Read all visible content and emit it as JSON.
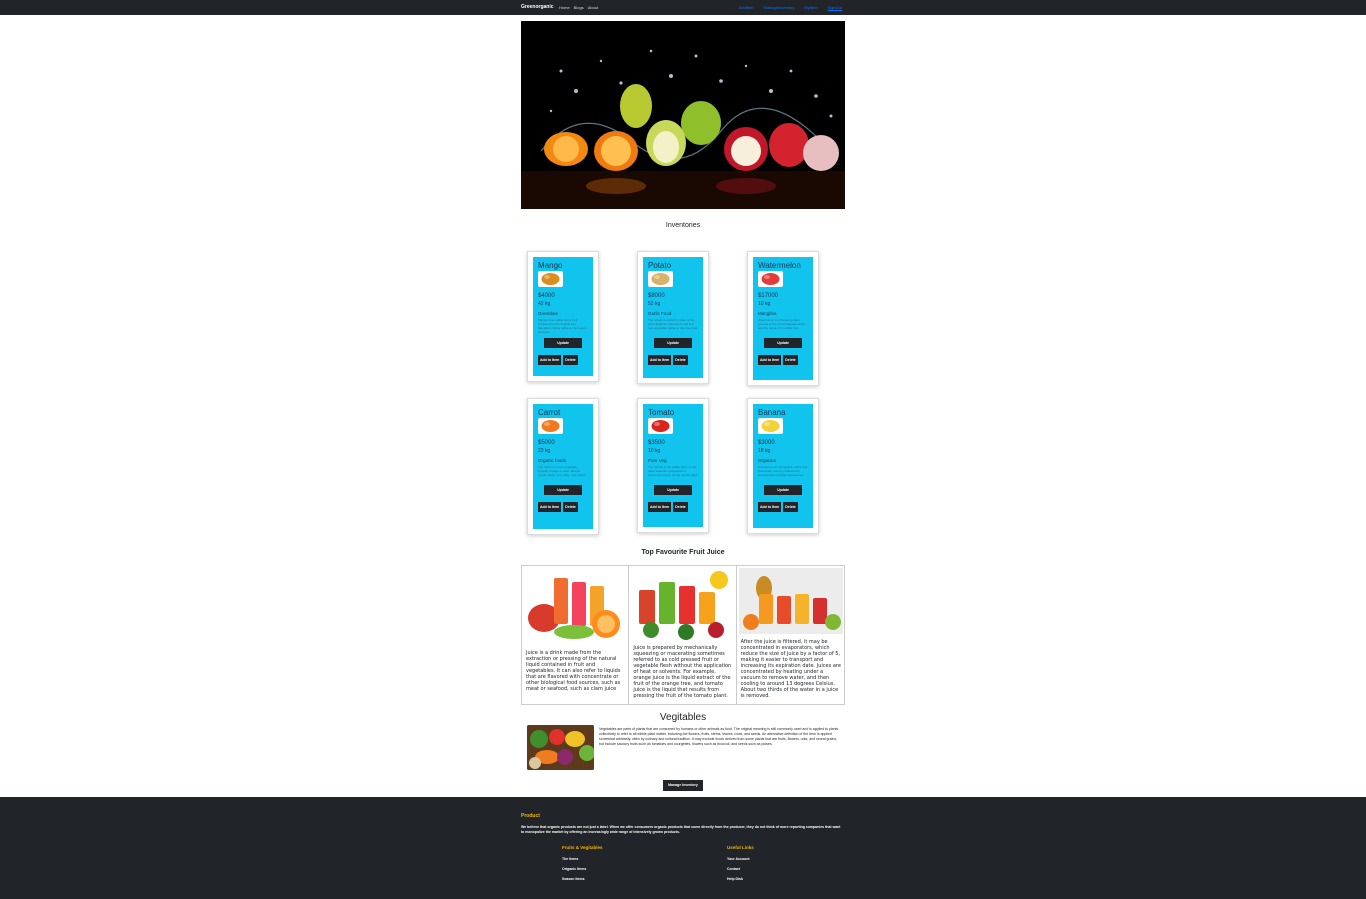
{
  "navbar": {
    "brand": "Greenorganic",
    "left_links": [
      "Home",
      "Blogs",
      "About"
    ],
    "right_links": [
      "AddItem",
      "ManageInventory",
      "MyItem",
      "SignOut"
    ]
  },
  "banner": {
    "slide_count": 3,
    "active_slide": 1
  },
  "inventory": {
    "title": "Inventories",
    "update_label": "Update",
    "add_label": "Add to Item",
    "delete_label": "Delete",
    "items": [
      {
        "name": "Mango",
        "price": "$4000",
        "quantity": "42 kg",
        "supplier": "Greenbee",
        "description": "Mango is an edible stone fruit produced by the tropical tree Mangifera indica native to the region between",
        "color": "#d98d1a"
      },
      {
        "name": "Potato",
        "price": "$8000",
        "quantity": "52 kg",
        "supplier": "Garlic Food",
        "description": "The potato is a starchy tuber of the plant Solanum tuberosum and is a root vegetable native to the Americas",
        "color": "#d9b26a"
      },
      {
        "name": "Watermelon",
        "price": "$17000",
        "quantity": "10 kg",
        "supplier": "Mangifea",
        "description": "Watermelon is a flowering plant species of the Cucurbitaceae family and the name of its edible fruit",
        "color": "#e23b3b"
      },
      {
        "name": "Carrot",
        "price": "$5000",
        "quantity": "23 kg",
        "supplier": "Organic foods",
        "description": "The carrot is a root vegetable typically orange in color, though purple, black, red, white, and yellow",
        "color": "#f07a1f"
      },
      {
        "name": "Tomato",
        "price": "$3500",
        "quantity": "10 kg",
        "supplier": "Pure Veg",
        "description": "The tomato is the edible berry of the plant Solanum lycopersicum, commonly known as the tomato plant",
        "color": "#d8261c"
      },
      {
        "name": "Banana",
        "price": "$3000",
        "quantity": "18 kg",
        "supplier": "Organics",
        "description": "A banana is an elongated, edible fruit botanically a berry produced by several kinds of large herbaceous",
        "color": "#f2d13a"
      }
    ]
  },
  "juice": {
    "title": "Top Favourite Fruit Juice",
    "items": [
      {
        "text": "Juice is a drink made from the extraction or pressing of the natural liquid contained in fruit and vegetables. It can also refer to liquids that are flavored with concentrate or other biological food sources, such as meat or seafood, such as clam juice"
      },
      {
        "text": "Juice is prepared by mechanically squeezing or macerating sometimes referred to as cold pressed fruit or vegetable flesh without the application of heat or solvents. For example, orange juice is the liquid extract of the fruit of the orange tree, and tomato juice is the liquid that results from pressing the fruit of the tomato plant."
      },
      {
        "text": "After the juice is filtered, it may be concentrated in evaporators, which reduce the size of juice by a factor of 5, making it easier to transport and increasing its expiration date. Juices are concentrated by heating under a vacuum to remove water, and then cooling to around 13 degrees Celsius. About two thirds of the water in a juice is removed."
      }
    ]
  },
  "vegetables": {
    "title": "Vegitables",
    "text": "Vegetables are parts of plants that are consumed by humans or other animals as food. The original meaning is still commonly used and is applied to plants collectively to refer to all edible plant matter, including the flowers, fruits, stems, leaves, roots, and seeds. An alternative definition of the term is applied somewhat arbitrarily, often by culinary and cultural tradition. It may exclude foods derived from some plants that are fruits, flowers, nuts, and cereal grains, but include savoury fruits such as tomatoes and courgettes, flowers such as broccoli, and seeds such as pulses.",
    "button_label": "Manage Inventory"
  },
  "footer": {
    "title": "Product",
    "text": "We believe that organic products are not just a label. When we offer consumers organic products that come directly from the producer, they do not think of more reporting companies that want to monopolize the market by offering an increasingly wide range of intensively grown products.",
    "col1": {
      "title": "Fruits & Vegitables",
      "items": [
        "The Items",
        "Origanic Items",
        "Season Items"
      ]
    },
    "col2": {
      "title": "Useful Links",
      "items": [
        "Your Account",
        "Contact",
        "Help Disk"
      ]
    }
  },
  "colors": {
    "navbar": "#212529",
    "card_accent": "#11c4ee",
    "footer_heading": "#f5b700",
    "link": "#0d6efd"
  }
}
